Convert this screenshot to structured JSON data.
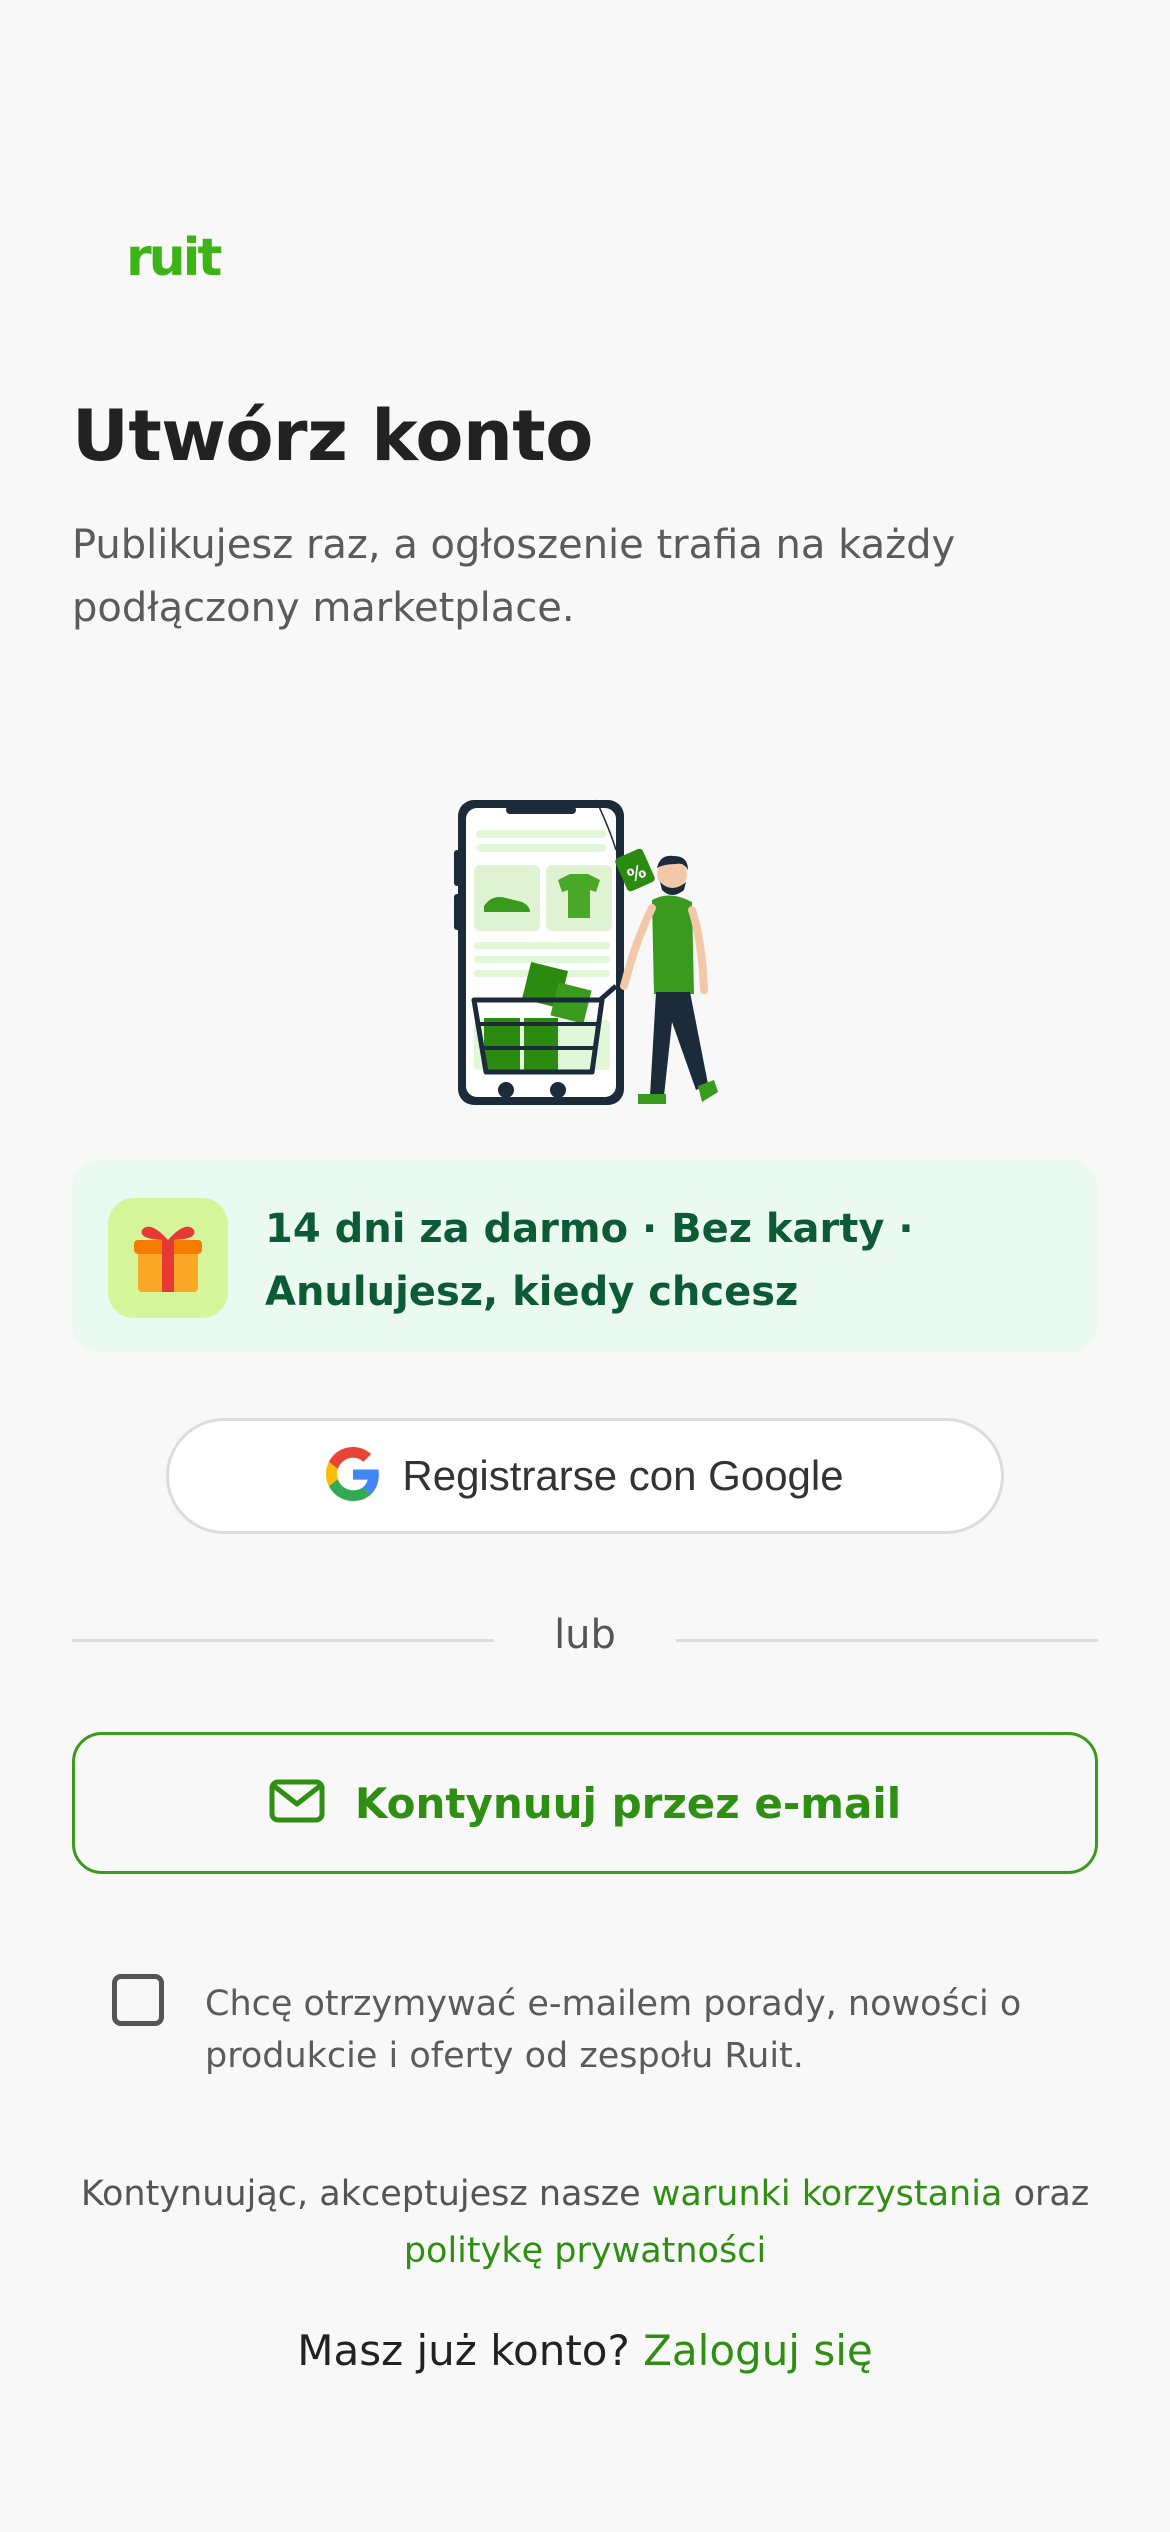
{
  "brand": {
    "logo_text": "ruit",
    "accent_color": "#3cb416"
  },
  "header": {
    "title": "Utwórz konto",
    "subtitle": "Publikujesz raz, a ogłoszenie trafia na każdy podłączony marketplace."
  },
  "illustration": {
    "icon": "shopping-phone-illustration"
  },
  "promo": {
    "icon": "gift-icon",
    "line1": "14 dni za darmo · Bez karty ·",
    "line2": "Anulujesz, kiedy chcesz"
  },
  "google_button": {
    "label": "Registrarse con Google",
    "icon": "google-icon"
  },
  "divider": {
    "text": "lub"
  },
  "email_button": {
    "label": "Kontynuuj przez e-mail",
    "icon": "mail-icon"
  },
  "newsletter": {
    "checked": false,
    "text": "Chcę otrzymywać e-mailem porady, nowości o produkcie i oferty od zespołu Ruit."
  },
  "legal": {
    "prefix": "Kontynuując, akceptujesz nasze",
    "terms_link": "warunki korzystania",
    "conjunction": "oraz",
    "privacy_link": "politykę prywatności"
  },
  "login": {
    "prompt": "Masz już konto?",
    "link": "Zaloguj się"
  }
}
